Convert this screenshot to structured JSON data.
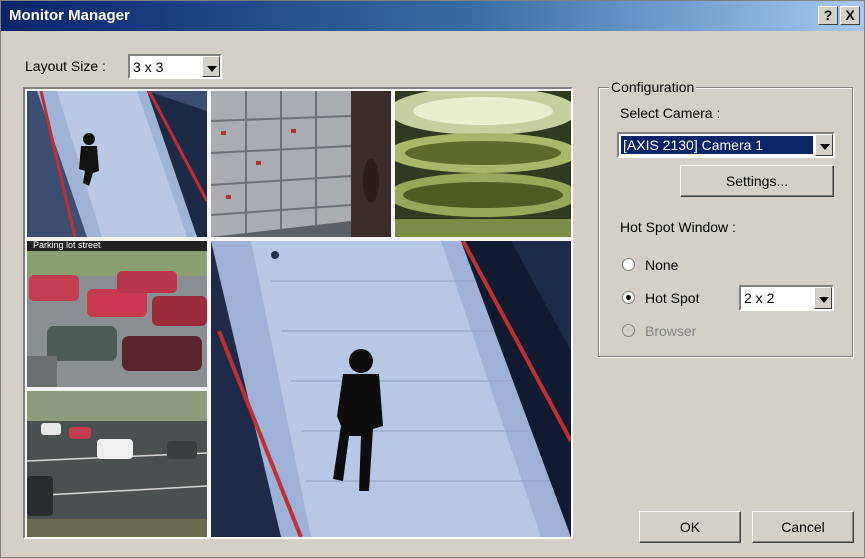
{
  "window": {
    "title": "Monitor Manager",
    "help_label": "?",
    "close_label": "X"
  },
  "layout": {
    "label": "Layout Size :",
    "value": "3 x 3"
  },
  "preview": {
    "cells": [
      "corridor-camera",
      "server-room-camera",
      "atrium-camera",
      "parking-lot-camera-1",
      "corridor-camera-large",
      "parking-lot-camera-2"
    ],
    "overlay_text": "Parking lot street"
  },
  "configuration": {
    "legend": "Configuration",
    "select_camera_label": "Select Camera :",
    "camera_value": "[AXIS 2130] Camera 1",
    "settings_label": "Settings...",
    "hot_spot_window_label": "Hot Spot Window :",
    "radios": {
      "none": "None",
      "hot_spot": "Hot Spot",
      "browser": "Browser"
    },
    "hot_spot_value": "2 x 2",
    "selected": "hot_spot"
  },
  "buttons": {
    "ok": "OK",
    "cancel": "Cancel"
  },
  "colors": {
    "titlebar_start": "#0a246a",
    "selection": "#0a246a",
    "face": "#d4d0c8"
  }
}
